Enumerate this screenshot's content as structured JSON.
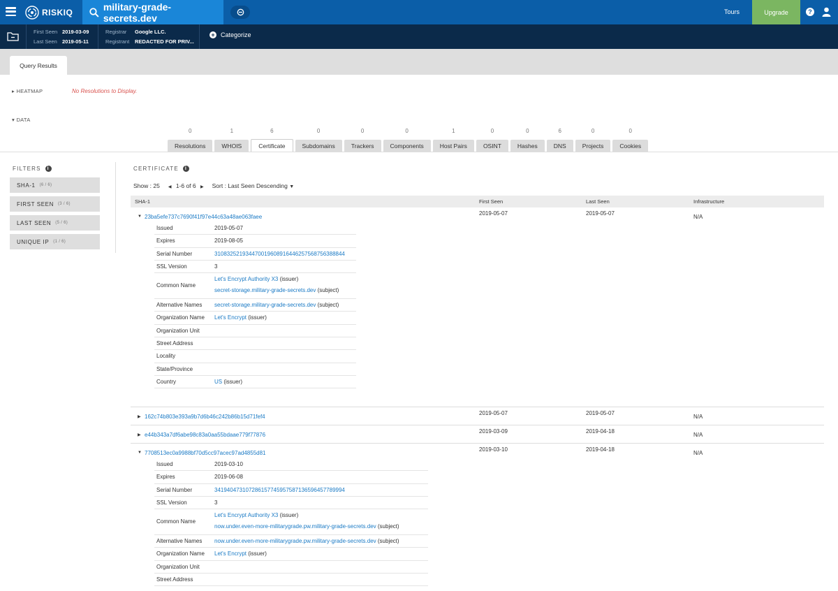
{
  "topbar": {
    "brand": "RISKIQ",
    "search_query": "military-grade-secrets.dev",
    "tours_label": "Tours",
    "upgrade_label": "Upgrade",
    "help_glyph": "?"
  },
  "info": {
    "first_seen_label": "First Seen",
    "first_seen": "2019-03-09",
    "last_seen_label": "Last Seen",
    "last_seen": "2019-05-11",
    "registrar_label": "Registrar",
    "registrar": "Google LLC.",
    "registrant_label": "Registrant",
    "registrant": "REDACTED FOR PRIV...",
    "categorize_label": "Categorize"
  },
  "query_tab_label": "Query Results",
  "heatmap": {
    "label": "HEATMAP",
    "message": "No Resolutions to Display."
  },
  "data_label": "DATA",
  "data_tabs": [
    {
      "label": "Resolutions",
      "count": "0"
    },
    {
      "label": "WHOIS",
      "count": "1"
    },
    {
      "label": "Certificate",
      "count": "6"
    },
    {
      "label": "Subdomains",
      "count": "0"
    },
    {
      "label": "Trackers",
      "count": "0"
    },
    {
      "label": "Components",
      "count": "0"
    },
    {
      "label": "Host Pairs",
      "count": "1"
    },
    {
      "label": "OSINT",
      "count": "0"
    },
    {
      "label": "Hashes",
      "count": "0"
    },
    {
      "label": "DNS",
      "count": "6"
    },
    {
      "label": "Projects",
      "count": "0"
    },
    {
      "label": "Cookies",
      "count": "0"
    }
  ],
  "active_tab": "Certificate",
  "filters": {
    "title": "FILTERS",
    "info_glyph": "i",
    "items": [
      {
        "label": "SHA-1",
        "count": "(6 / 6)"
      },
      {
        "label": "FIRST SEEN",
        "count": "(3 / 6)"
      },
      {
        "label": "LAST SEEN",
        "count": "(5 / 6)"
      },
      {
        "label": "UNIQUE IP",
        "count": "(1 / 6)"
      }
    ]
  },
  "certificate": {
    "title": "CERTIFICATE",
    "show": "Show : 25",
    "pager": "1-6 of 6",
    "sort": "Sort : Last Seen Descending",
    "columns": [
      "SHA-1",
      "First Seen",
      "Last Seen",
      "Infrastructure"
    ],
    "rows": [
      {
        "sha1": "23ba5efe737c7690f41f97e44c63a48ae063faee",
        "first_seen": "2019-05-07",
        "last_seen": "2019-05-07",
        "infrastructure": "N/A",
        "expanded": true,
        "details": [
          {
            "key": "Issued",
            "values": [
              {
                "text": "2019-05-07",
                "link": false
              }
            ]
          },
          {
            "key": "Expires",
            "values": [
              {
                "text": "2019-08-05",
                "link": false
              }
            ]
          },
          {
            "key": "Serial Number",
            "values": [
              {
                "text": "310832521934470019608916446257568756388844",
                "link": true
              }
            ]
          },
          {
            "key": "SSL Version",
            "values": [
              {
                "text": "3",
                "link": false
              }
            ]
          },
          {
            "key": "Common Name",
            "values": [
              {
                "text": "Let's Encrypt Authority X3",
                "link": true,
                "suffix": "(issuer)"
              },
              {
                "text": "secret-storage.military-grade-secrets.dev",
                "link": true,
                "suffix": "(subject)"
              }
            ]
          },
          {
            "key": "Alternative Names",
            "values": [
              {
                "text": "secret-storage.military-grade-secrets.dev",
                "link": true,
                "suffix": "(subject)"
              }
            ]
          },
          {
            "key": "Organization Name",
            "values": [
              {
                "text": "Let's Encrypt",
                "link": true,
                "suffix": "(issuer)"
              }
            ]
          },
          {
            "key": "Organization Unit",
            "values": []
          },
          {
            "key": "Street Address",
            "values": []
          },
          {
            "key": "Locality",
            "values": []
          },
          {
            "key": "State/Province",
            "values": []
          },
          {
            "key": "Country",
            "values": [
              {
                "text": "US",
                "link": true,
                "suffix": "(issuer)"
              }
            ]
          }
        ]
      },
      {
        "sha1": "162c74b803e393a9b7d6b46c242b86b15d71fef4",
        "first_seen": "2019-05-07",
        "last_seen": "2019-05-07",
        "infrastructure": "N/A",
        "expanded": false
      },
      {
        "sha1": "e44b343a7df6abe98c83a0aa55bdaae779f77876",
        "first_seen": "2019-03-09",
        "last_seen": "2019-04-18",
        "infrastructure": "N/A",
        "expanded": false
      },
      {
        "sha1": "7708513ec0a9988bf70d5cc97acec97ad4855d81",
        "first_seen": "2019-03-10",
        "last_seen": "2019-04-18",
        "infrastructure": "N/A",
        "expanded": true,
        "details": [
          {
            "key": "Issued",
            "values": [
              {
                "text": "2019-03-10",
                "link": false
              }
            ]
          },
          {
            "key": "Expires",
            "values": [
              {
                "text": "2019-06-08",
                "link": false
              }
            ]
          },
          {
            "key": "Serial Number",
            "values": [
              {
                "text": "341940473107286157745957587136596457789994",
                "link": true
              }
            ]
          },
          {
            "key": "SSL Version",
            "values": [
              {
                "text": "3",
                "link": false
              }
            ]
          },
          {
            "key": "Common Name",
            "values": [
              {
                "text": "Let's Encrypt Authority X3",
                "link": true,
                "suffix": "(issuer)"
              },
              {
                "text": "now.under.even-more-militarygrade.pw.military-grade-secrets.dev",
                "link": true,
                "suffix": "(subject)"
              }
            ]
          },
          {
            "key": "Alternative Names",
            "values": [
              {
                "text": "now.under.even-more-militarygrade.pw.military-grade-secrets.dev",
                "link": true,
                "suffix": "(subject)"
              }
            ]
          },
          {
            "key": "Organization Name",
            "values": [
              {
                "text": "Let's Encrypt",
                "link": true,
                "suffix": "(issuer)"
              }
            ]
          },
          {
            "key": "Organization Unit",
            "values": []
          },
          {
            "key": "Street Address",
            "values": []
          }
        ]
      }
    ]
  },
  "colors": {
    "topbar": "#0b5ea8",
    "search": "#1a86d8",
    "infobar": "#0b2a4a",
    "upgrade": "#7bb661",
    "link": "#1a7ac5",
    "error": "#d9534f"
  }
}
